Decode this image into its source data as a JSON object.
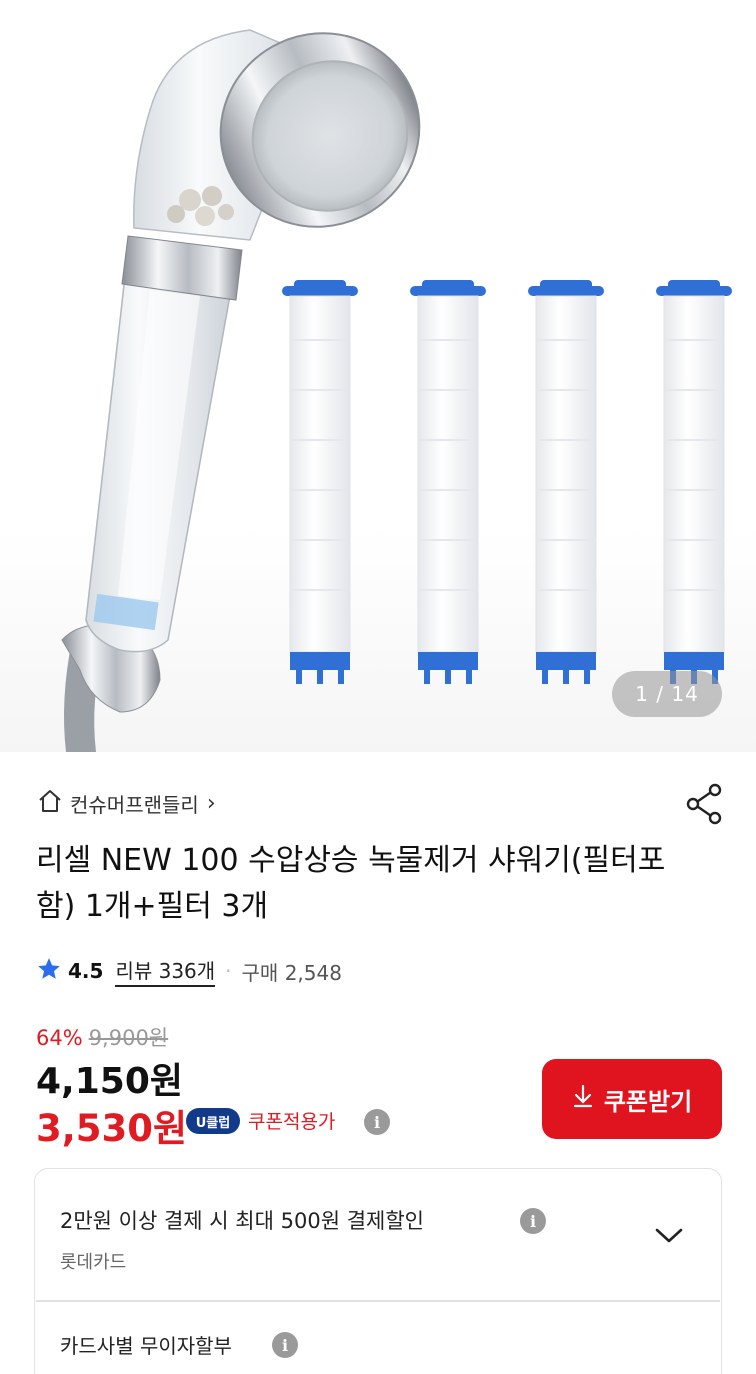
{
  "gallery": {
    "counter": "1 / 14"
  },
  "store": {
    "name": "컨슈머프랜들리",
    "chevron": "›"
  },
  "product": {
    "title": "리셀 NEW 100 수압상승 녹물제거 샤워기(필터포함) 1개+필터 3개"
  },
  "rating": {
    "score": "4.5",
    "reviews": "리뷰 336개",
    "separator": "·",
    "purchases": "구매 2,548"
  },
  "pricing": {
    "discount_rate": "64%",
    "original_price": "9,900원",
    "price": "4,150원",
    "coupon_price": "3,530원",
    "uclub_badge": "U클럽",
    "coupon_note": "쿠폰적용가",
    "coupon_button": "쿠폰받기"
  },
  "benefits": {
    "card_discount": "2만원 이상 결제 시 최대 500원 결제할인",
    "card_name": "롯데카드",
    "installment": "카드사별 무이자할부"
  },
  "icons": {
    "home": "home-icon",
    "share": "share-icon",
    "star": "star-icon",
    "info": "info-icon",
    "download": "download-icon",
    "expand": "chevron-down-icon"
  },
  "colors": {
    "accent_red": "#e01b22",
    "star_blue": "#2a6ef0",
    "uclub_navy": "#123a8a",
    "filter_blue": "#2f6fd6"
  }
}
